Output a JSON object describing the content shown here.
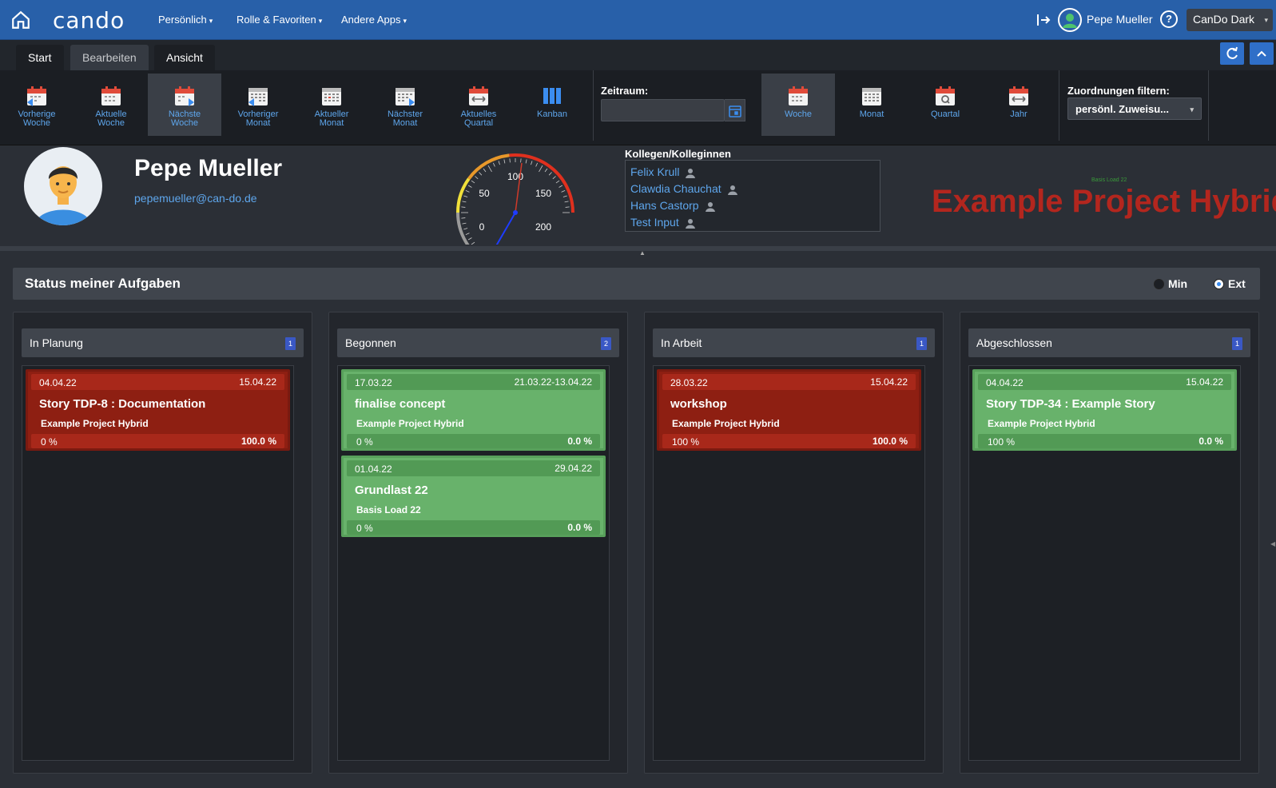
{
  "topbar": {
    "logo": "cando",
    "menus": [
      "Persönlich",
      "Rolle & Favoriten",
      "Andere Apps"
    ],
    "caret": "▾",
    "user_name": "Pepe Mueller",
    "help": "?",
    "theme": "CanDo Dark"
  },
  "tabs": [
    "Start",
    "Bearbeiten",
    "Ansicht"
  ],
  "toolbar": {
    "nav_buttons": [
      {
        "line1": "Vorherige",
        "line2": "Woche"
      },
      {
        "line1": "Aktuelle",
        "line2": "Woche"
      },
      {
        "line1": "Nächste",
        "line2": "Woche"
      },
      {
        "line1": "Vorheriger",
        "line2": "Monat"
      },
      {
        "line1": "Aktueller",
        "line2": "Monat"
      },
      {
        "line1": "Nächster",
        "line2": "Monat"
      },
      {
        "line1": "Aktuelles",
        "line2": "Quartal"
      },
      {
        "line1": "Kanban",
        "line2": ""
      }
    ],
    "range_label": "Zeitraum:",
    "range_value": "",
    "period_buttons": [
      "Woche",
      "Monat",
      "Quartal",
      "Jahr"
    ],
    "filter_label": "Zuordnungen filtern:",
    "filter_value": "persönl. Zuweisu..."
  },
  "profile": {
    "name": "Pepe Mueller",
    "email": "pepemueller@can-do.de",
    "gauge": {
      "ticks": [
        "0",
        "50",
        "100",
        "150",
        "200"
      ],
      "value": 0
    },
    "colleagues_title": "Kollegen/Kolleginnen",
    "colleagues": [
      "Felix Krull",
      "Clawdia Chauchat",
      "Hans Castorp",
      "Test Input"
    ],
    "project_small": "Basis Load 22",
    "project_big": "Example Project Hybrid"
  },
  "status": {
    "title": "Status meiner Aufgaben",
    "options": [
      "Min",
      "Ext"
    ],
    "selected": "Ext"
  },
  "colors": {
    "accent": "#2860a9",
    "red_card": "#8e1f12",
    "green_card": "#68b26b",
    "link": "#5ea6ec"
  },
  "columns": [
    {
      "title": "In Planung",
      "count": "1",
      "cards": [
        {
          "color": "red",
          "start": "04.04.22",
          "end": "15.04.22",
          "title": "Story TDP-8 : Documentation",
          "project": "Example Project Hybrid",
          "progress": "0 %",
          "planned": "100.0 %"
        }
      ]
    },
    {
      "title": "Begonnen",
      "count": "2",
      "cards": [
        {
          "color": "green",
          "start": "17.03.22",
          "end": "21.03.22-13.04.22",
          "title": "finalise concept",
          "project": "Example Project Hybrid",
          "progress": "0 %",
          "planned": "0.0 %"
        },
        {
          "color": "green",
          "start": "01.04.22",
          "end": "29.04.22",
          "title": "Grundlast 22",
          "project": "Basis Load 22",
          "progress": "0 %",
          "planned": "0.0 %"
        }
      ]
    },
    {
      "title": "In Arbeit",
      "count": "1",
      "cards": [
        {
          "color": "red",
          "start": "28.03.22",
          "end": "15.04.22",
          "title": "workshop",
          "project": "Example Project Hybrid",
          "progress": "100 %",
          "planned": "100.0 %"
        }
      ]
    },
    {
      "title": "Abgeschlossen",
      "count": "1",
      "cards": [
        {
          "color": "green",
          "start": "04.04.22",
          "end": "15.04.22",
          "title": "Story TDP-34 : Example Story",
          "project": "Example Project Hybrid",
          "progress": "100 %",
          "planned": "0.0 %"
        }
      ]
    }
  ]
}
